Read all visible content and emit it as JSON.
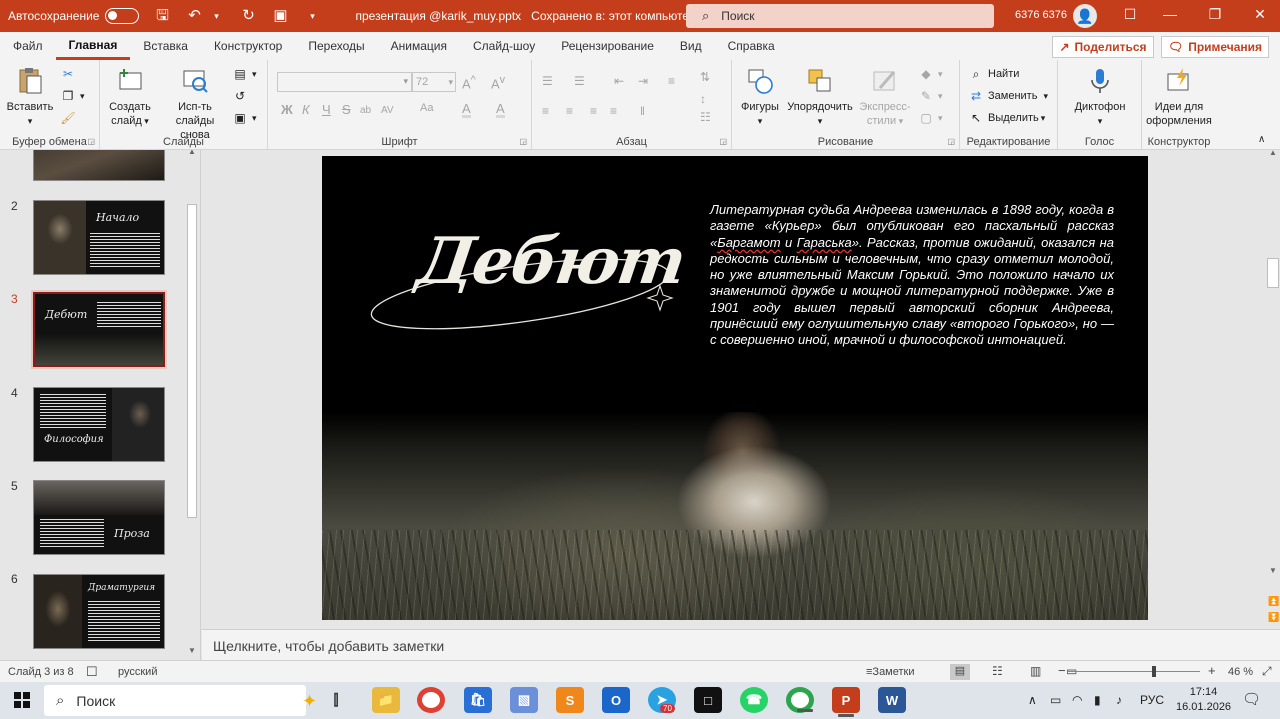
{
  "titlebar": {
    "autosave_label": "Автосохранение",
    "autosave_state": "off",
    "filename": "презентация @karik_muy.pptx",
    "saved_status": "Сохранено в: этот компьютер",
    "search_placeholder": "Поиск",
    "user_name": "6376 6376"
  },
  "tabs": [
    "Файл",
    "Главная",
    "Вставка",
    "Конструктор",
    "Переходы",
    "Анимация",
    "Слайд-шоу",
    "Рецензирование",
    "Вид",
    "Справка"
  ],
  "active_tab": "Главная",
  "share_label": "Поделиться",
  "comments_label": "Примечания",
  "ribbon": {
    "clipboard": {
      "label": "Буфер обмена",
      "paste": "Вставить"
    },
    "slides": {
      "label": "Слайды",
      "new_slide_1": "Создать",
      "new_slide_2": "слайд",
      "reuse_1": "Исп-ть",
      "reuse_2": "слайды снова"
    },
    "font": {
      "label": "Шрифт",
      "size": "72",
      "bold": "Ж",
      "italic": "К",
      "underline": "Ч",
      "strike": "S",
      "case": "ab",
      "spacing": "AV",
      "clear": "Aa",
      "highlight": "A",
      "color": "A"
    },
    "paragraph": {
      "label": "Абзац"
    },
    "drawing": {
      "label": "Рисование",
      "shapes": "Фигуры",
      "arrange": "Упорядочить",
      "styles_1": "Экспресс-",
      "styles_2": "стили"
    },
    "editing": {
      "label": "Редактирование",
      "find": "Найти",
      "replace": "Заменить",
      "select": "Выделить"
    },
    "voice": {
      "label": "Голос",
      "dictate": "Диктофон"
    },
    "designer": {
      "label": "Конструктор",
      "ideas_1": "Идеи для",
      "ideas_2": "оформления"
    }
  },
  "thumbnails": [
    {
      "num": "2",
      "title": "Начало"
    },
    {
      "num": "3",
      "title": "Дебют",
      "active": true
    },
    {
      "num": "4",
      "title": "Философия"
    },
    {
      "num": "5",
      "title": "Проза"
    },
    {
      "num": "6",
      "title": "Драматургия"
    }
  ],
  "slide": {
    "title": "Дебют",
    "text_parts": [
      "Литературная судьба Андреева изменилась в 1898 году, когда в газете «Курьер» был опубликован его пасхальный рассказ «",
      "Баргамот",
      " и ",
      "Гараська",
      "». Рассказ, против ожиданий, оказался на редкость сильным и человечным, что сразу отметил молодой, но уже влиятельный Максим Горький. Это положило начало их знаменитой дружбе и мощной литературной поддержке. Уже в 1901 году вышел первый авторский сборник Андреева, принёсший ему оглушительную славу «второго Горького», но — с совершенно иной, мрачной и философской интонацией."
    ]
  },
  "notes_placeholder": "Щелкните, чтобы добавить заметки",
  "statusbar": {
    "slide_info": "Слайд 3 из 8",
    "language": "русский",
    "notes_label": "Заметки",
    "zoom": "46 %",
    "zoom_fraction": 0.46
  },
  "taskbar": {
    "search_label": "Поиск",
    "telegram_badge": "70",
    "language": "РУС",
    "time": "17:14",
    "date": "16.01.2026"
  }
}
